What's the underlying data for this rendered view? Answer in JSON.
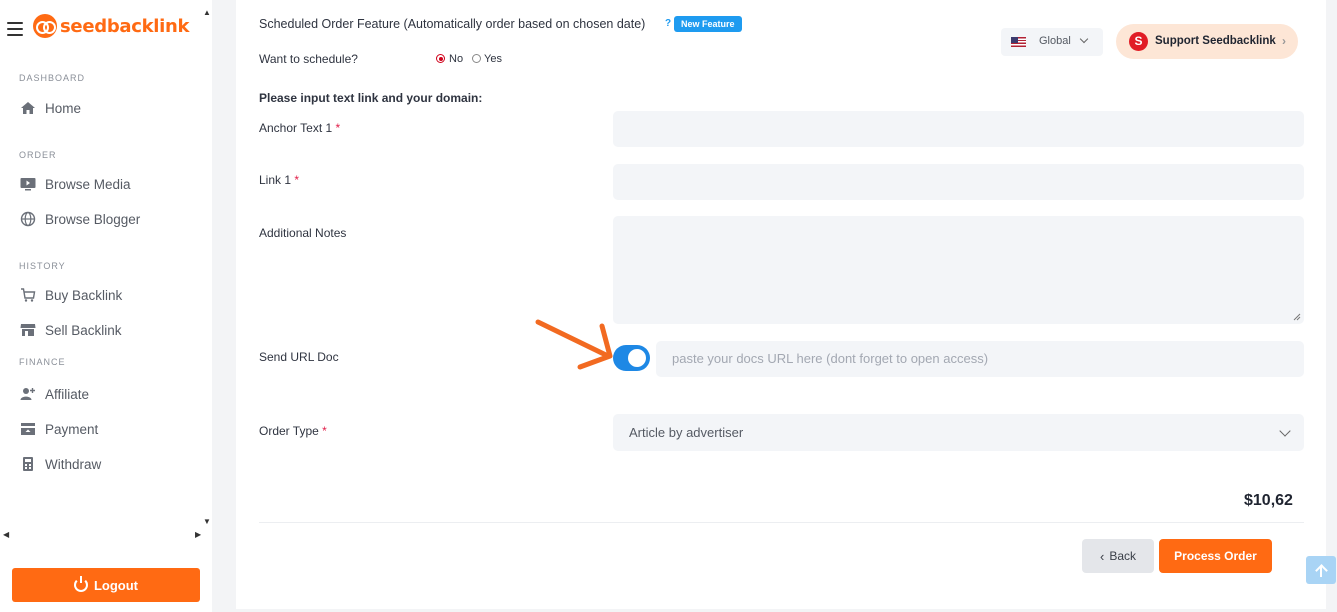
{
  "brand": {
    "name": "seedbacklink"
  },
  "sidebar": {
    "sections": {
      "dashboard": "DASHBOARD",
      "order": "ORDER",
      "history": "HISTORY",
      "finance": "FINANCE"
    },
    "items": {
      "home": "Home",
      "browse_media": "Browse Media",
      "browse_blogger": "Browse Blogger",
      "buy_backlink": "Buy Backlink",
      "sell_backlink": "Sell Backlink",
      "affiliate": "Affiliate",
      "payment": "Payment",
      "withdraw": "Withdraw"
    },
    "logout": "Logout"
  },
  "header": {
    "region": "Global",
    "support": "Support Seedbacklink",
    "support_initial": "S"
  },
  "form": {
    "scheduled_label": "Scheduled Order Feature (Automatically order based on chosen date)",
    "help_mark": "?",
    "new_feature_badge": "New Feature",
    "want_schedule_label": "Want to schedule?",
    "radio_no": "No",
    "radio_yes": "Yes",
    "instruction": "Please input text link and your domain:",
    "anchor_label": "Anchor Text 1",
    "link_label": "Link 1",
    "notes_label": "Additional Notes",
    "send_doc_label": "Send URL Doc",
    "doc_placeholder": "paste your docs URL here (dont forget to open access)",
    "order_type_label": "Order Type",
    "order_type_value": "Article by advertiser",
    "required_mark": "*"
  },
  "summary": {
    "price": "$10,62"
  },
  "actions": {
    "back": "Back",
    "back_icon": "‹",
    "process": "Process Order"
  }
}
